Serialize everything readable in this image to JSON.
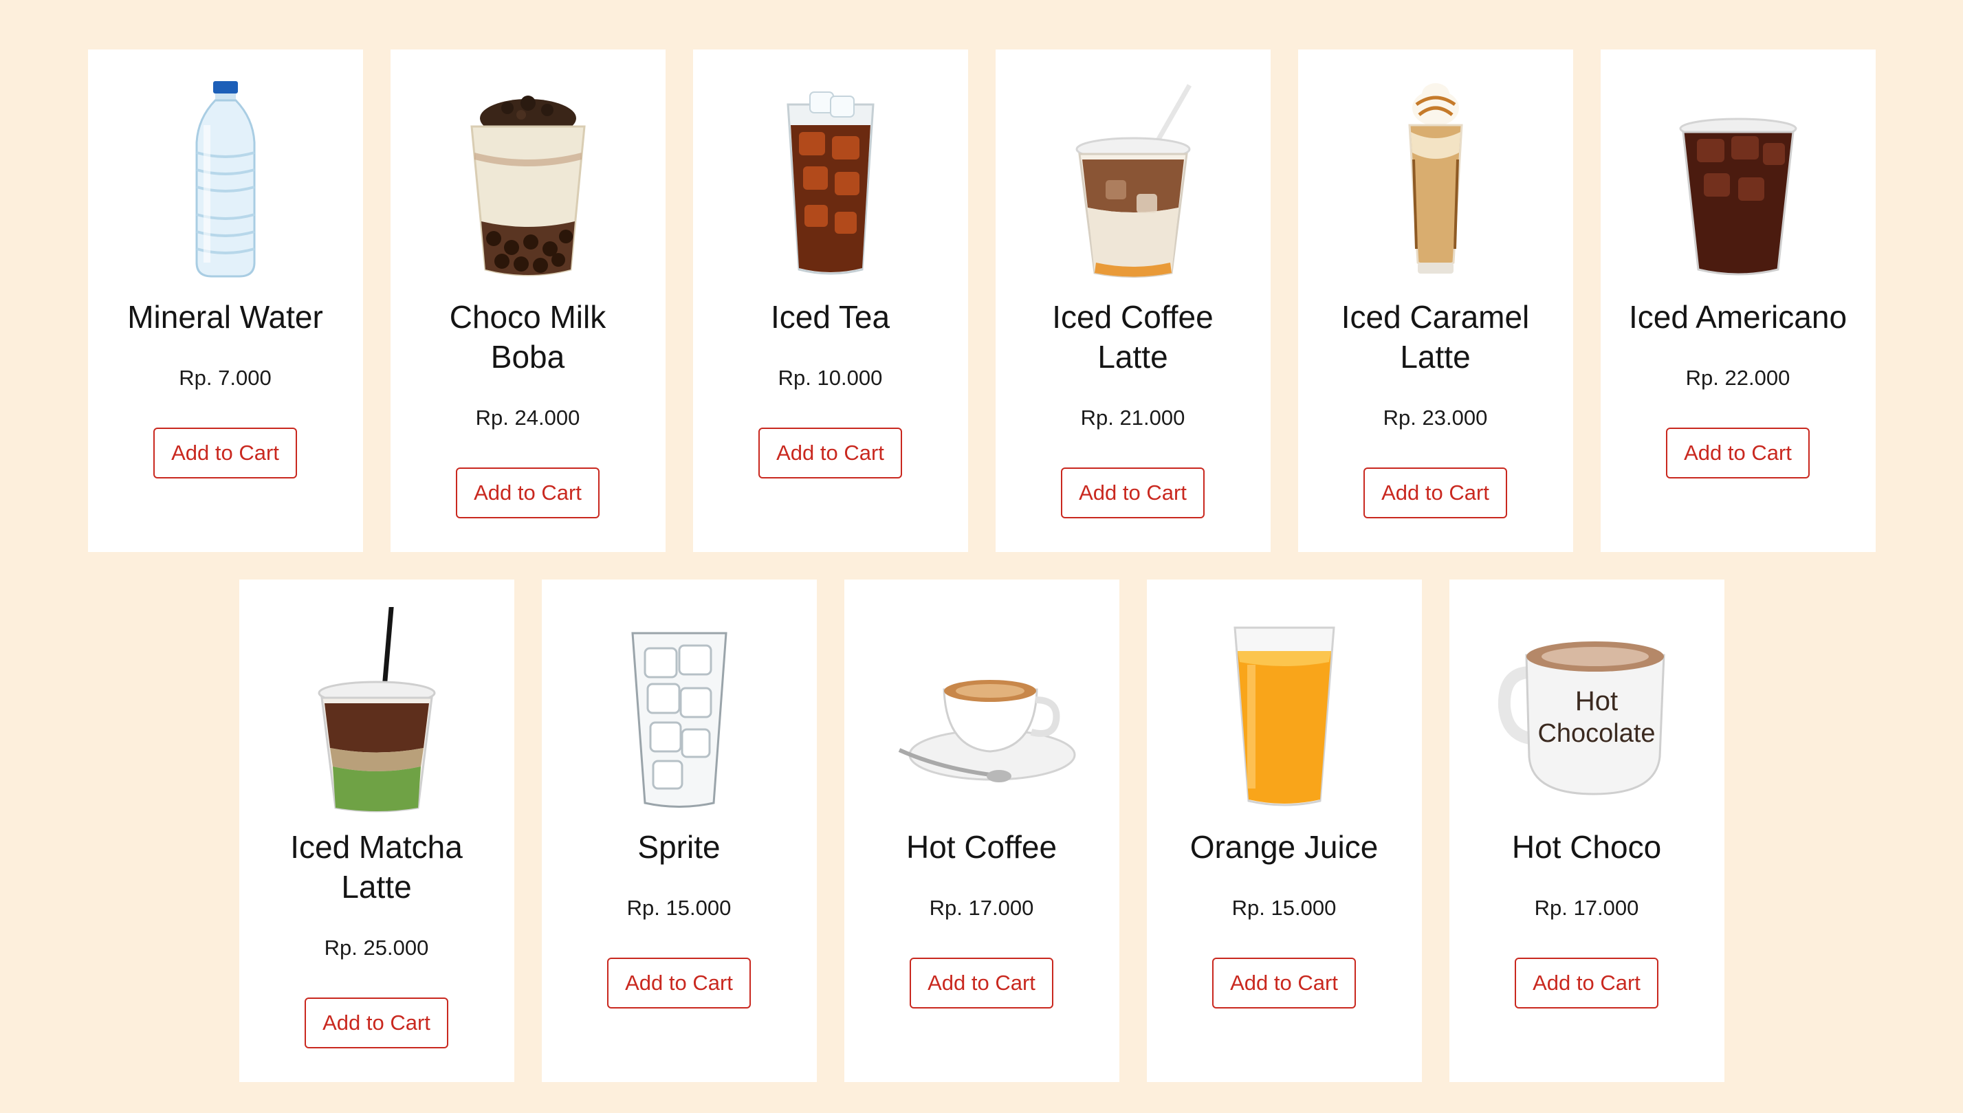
{
  "products": [
    {
      "name": "Mineral Water",
      "price": "Rp. 7.000",
      "button": "Add to Cart",
      "icon": "mineral-water-bottle-icon"
    },
    {
      "name": "Choco Milk Boba",
      "price": "Rp. 24.000",
      "button": "Add to Cart",
      "icon": "choco-milk-boba-icon"
    },
    {
      "name": "Iced Tea",
      "price": "Rp. 10.000",
      "button": "Add to Cart",
      "icon": "iced-tea-glass-icon"
    },
    {
      "name": "Iced Coffee Latte",
      "price": "Rp. 21.000",
      "button": "Add to Cart",
      "icon": "iced-coffee-latte-icon"
    },
    {
      "name": "Iced Caramel Latte",
      "price": "Rp. 23.000",
      "button": "Add to Cart",
      "icon": "iced-caramel-latte-icon"
    },
    {
      "name": "Iced Americano",
      "price": "Rp. 22.000",
      "button": "Add to Cart",
      "icon": "iced-americano-icon"
    },
    {
      "name": "Iced Matcha Latte",
      "price": "Rp. 25.000",
      "button": "Add to Cart",
      "icon": "iced-matcha-latte-icon"
    },
    {
      "name": "Sprite",
      "price": "Rp. 15.000",
      "button": "Add to Cart",
      "icon": "sprite-glass-icon"
    },
    {
      "name": "Hot Coffee",
      "price": "Rp. 17.000",
      "button": "Add to Cart",
      "icon": "hot-coffee-cup-icon"
    },
    {
      "name": "Orange Juice",
      "price": "Rp. 15.000",
      "button": "Add to Cart",
      "icon": "orange-juice-glass-icon"
    },
    {
      "name": "Hot Choco",
      "price": "Rp. 17.000",
      "button": "Add to Cart",
      "icon": "hot-chocolate-mug-icon",
      "mug_text": [
        "Hot",
        "Chocolate"
      ]
    }
  ],
  "colors": {
    "page_background": "#fdefdc",
    "card_background": "#ffffff",
    "button_accent": "#c9281f"
  }
}
